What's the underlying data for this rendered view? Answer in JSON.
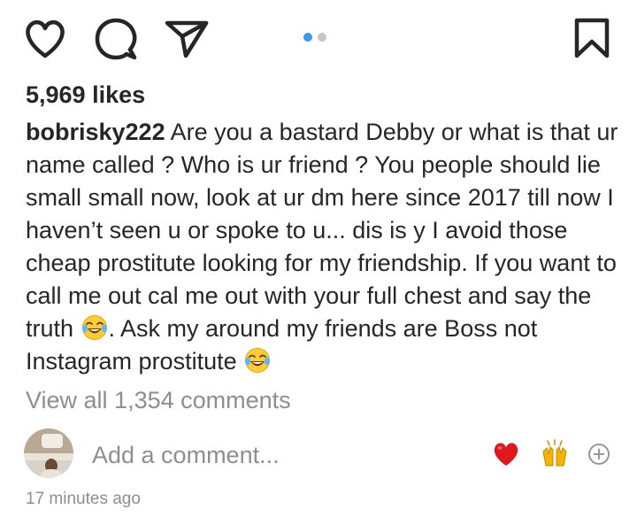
{
  "post": {
    "likes_text": "5,969 likes",
    "caption": {
      "username": "bobrisky222",
      "text_part1": " Are you a bastard Debby or what is that ur name called ? Who is ur friend ? You people should lie small small now, look at ur dm here since 2017 till now I haven’t seen u or spoke to u... dis is y I avoid those cheap prostitute looking for my friendship. If you want to call me out cal me out with your full chest and say the truth ",
      "emoji1": "face-with-tears-of-joy",
      "text_part2": ". Ask my around my friends are Boss not Instagram prostitute ",
      "emoji2": "face-with-tears-of-joy"
    },
    "view_comments_label": "View all 1,354 comments",
    "timestamp": "17 minutes ago"
  },
  "action_bar": {
    "icons": [
      "heart-icon",
      "comment-icon",
      "share-icon",
      "bookmark-icon"
    ],
    "carousel": {
      "pages": 2,
      "active_page": 1,
      "active_color": "#3897f0",
      "inactive_color": "#c7c7c7"
    }
  },
  "comment_box": {
    "placeholder": "Add a comment...",
    "quick_reactions": [
      "red-heart-emoji",
      "raising-hands-emoji",
      "add-reaction-icon"
    ]
  },
  "colors": {
    "text": "#262626",
    "muted": "#8e8e8e",
    "heart": "#e0191f",
    "hands": "#f4b400"
  }
}
